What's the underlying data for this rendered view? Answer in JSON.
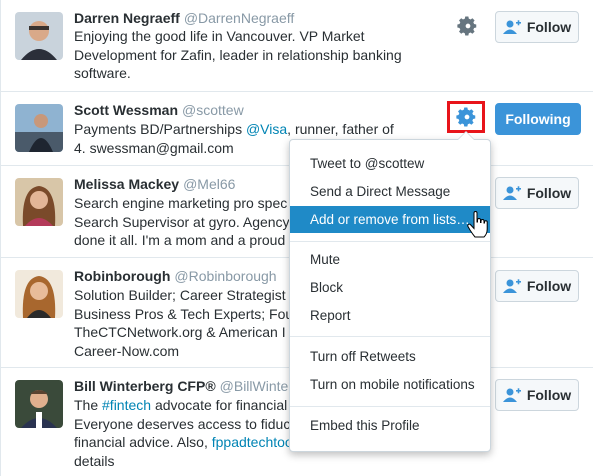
{
  "users": [
    {
      "name": "Darren Negraeff",
      "handle": "@DarrenNegraeff",
      "bio_parts": [
        "Enjoying the good life in Vancouver. VP Market Development for Zafin, leader in relationship banking software."
      ],
      "button": "Follow"
    },
    {
      "name": "Scott Wessman",
      "handle": "@scottew",
      "bio_parts": [
        "Payments BD/Partnerships ",
        "@Visa",
        ", runner, father of 4. swessman@gmail.com"
      ],
      "button": "Following"
    },
    {
      "name": "Melissa Mackey",
      "handle": "@Mel66",
      "bio_lines": [
        "Search engine marketing pro spec",
        "Search Supervisor at gyro. Agency",
        "done it all. I'm a mom and a proud"
      ],
      "button": "Follow"
    },
    {
      "name": "Robinborough",
      "handle": "@Robinborough",
      "bio_lines": [
        "Solution Builder; Career Strategist",
        "Business Pros & Tech Experts; Fou",
        "TheCTCNetwork.org & American I",
        "Career-Now.com"
      ],
      "button": "Follow"
    },
    {
      "name": "Bill Winterberg CFP®",
      "handle": "@BillWinter",
      "bio_line1": [
        "The ",
        "#fintech",
        " advocate for financial"
      ],
      "bio_line2": "Everyone deserves access to fiduc",
      "bio_line3": [
        "financial advice. Also, ",
        "fppadtechtoo"
      ],
      "bio_line4": "details",
      "button": "Follow"
    }
  ],
  "menu": {
    "items": [
      "Tweet to @scottew",
      "Send a Direct Message",
      "Add or remove from lists…",
      "Mute",
      "Block",
      "Report",
      "Turn off Retweets",
      "Turn on mobile notifications",
      "Embed this Profile"
    ],
    "active_index": 2
  },
  "colors": {
    "accent": "#3b94d9",
    "link": "#0084b4",
    "highlight": "#e8141a",
    "menu_active": "#1f8ac7"
  },
  "icons": {
    "settings": "gear-icon",
    "follow": "user-plus-icon",
    "cursor": "hand-pointer-icon"
  }
}
